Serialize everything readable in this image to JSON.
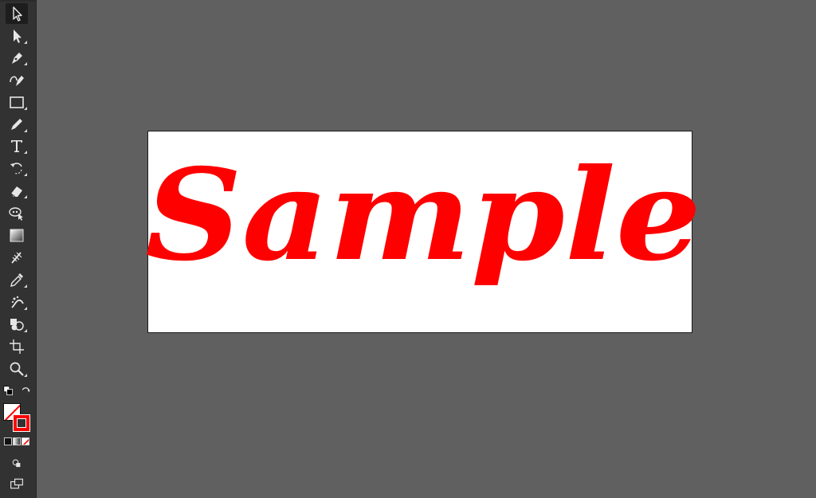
{
  "app": {
    "tools": [
      {
        "name": "selection-tool",
        "icon": "selection-arrow-icon",
        "active": true
      },
      {
        "name": "direct-selection-tool",
        "icon": "direct-selection-arrow-icon"
      },
      {
        "name": "pen-tool",
        "icon": "pen-icon"
      },
      {
        "name": "curvature-tool",
        "icon": "curvature-pen-icon"
      },
      {
        "name": "rectangle-tool",
        "icon": "rectangle-icon"
      },
      {
        "name": "pencil-tool",
        "icon": "pencil-icon"
      },
      {
        "name": "type-tool",
        "icon": "type-icon",
        "glyph": "T"
      },
      {
        "name": "rotate-tool",
        "icon": "rotate-icon"
      },
      {
        "name": "eraser-tool",
        "icon": "eraser-icon"
      },
      {
        "name": "puppet-warp-tool",
        "icon": "puppet-warp-icon"
      },
      {
        "name": "gradient-tool",
        "icon": "gradient-icon"
      },
      {
        "name": "mesh-tool",
        "icon": "mesh-icon"
      },
      {
        "name": "eyedropper-tool",
        "icon": "eyedropper-icon"
      },
      {
        "name": "symbol-sprayer-tool",
        "icon": "symbol-sprayer-icon"
      },
      {
        "name": "shape-builder-tool",
        "icon": "shape-builder-icon"
      },
      {
        "name": "artboard-tool",
        "icon": "artboard-icon"
      },
      {
        "name": "zoom-tool",
        "icon": "zoom-icon"
      }
    ],
    "colors": {
      "stroke": "#ff0000",
      "fill": "none",
      "canvas_bg": "#606060",
      "toolbar_bg": "#323232",
      "artboard_bg": "#ffffff"
    }
  },
  "artwork": {
    "text": "Sample",
    "color": "#ff0000"
  }
}
